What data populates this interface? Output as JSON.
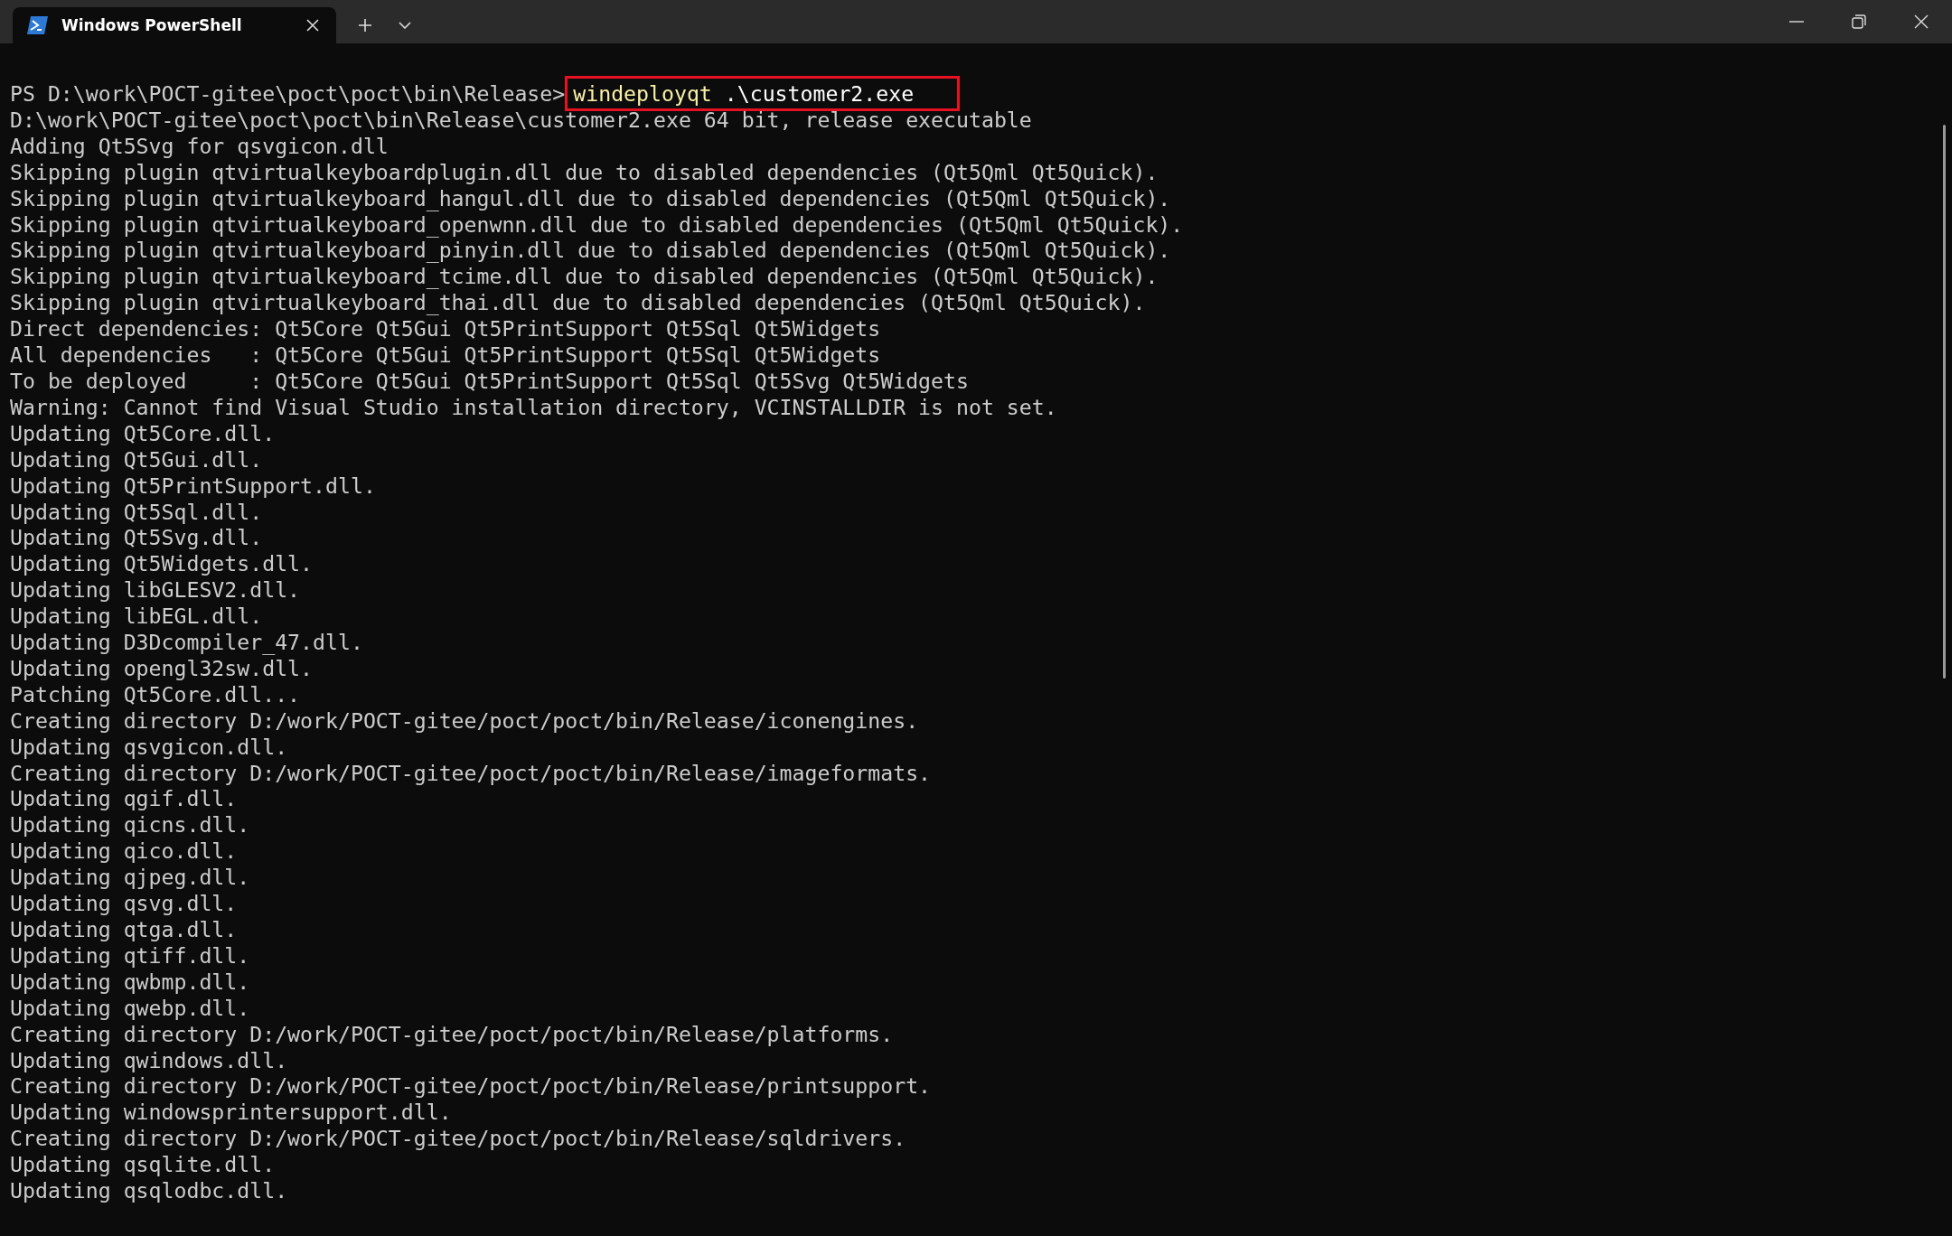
{
  "tab": {
    "title": "Windows PowerShell",
    "selected": true
  },
  "terminal": {
    "prompt": "PS D:\\work\\POCT-gitee\\poct\\poct\\bin\\Release>",
    "command_name": "windeployqt",
    "command_args": " .\\customer2.exe",
    "command_highlighted": true,
    "lines": [
      "D:\\work\\POCT-gitee\\poct\\poct\\bin\\Release\\customer2.exe 64 bit, release executable",
      "Adding Qt5Svg for qsvgicon.dll",
      "Skipping plugin qtvirtualkeyboardplugin.dll due to disabled dependencies (Qt5Qml Qt5Quick).",
      "Skipping plugin qtvirtualkeyboard_hangul.dll due to disabled dependencies (Qt5Qml Qt5Quick).",
      "Skipping plugin qtvirtualkeyboard_openwnn.dll due to disabled dependencies (Qt5Qml Qt5Quick).",
      "Skipping plugin qtvirtualkeyboard_pinyin.dll due to disabled dependencies (Qt5Qml Qt5Quick).",
      "Skipping plugin qtvirtualkeyboard_tcime.dll due to disabled dependencies (Qt5Qml Qt5Quick).",
      "Skipping plugin qtvirtualkeyboard_thai.dll due to disabled dependencies (Qt5Qml Qt5Quick).",
      "Direct dependencies: Qt5Core Qt5Gui Qt5PrintSupport Qt5Sql Qt5Widgets",
      "All dependencies   : Qt5Core Qt5Gui Qt5PrintSupport Qt5Sql Qt5Widgets",
      "To be deployed     : Qt5Core Qt5Gui Qt5PrintSupport Qt5Sql Qt5Svg Qt5Widgets",
      "Warning: Cannot find Visual Studio installation directory, VCINSTALLDIR is not set.",
      "Updating Qt5Core.dll.",
      "Updating Qt5Gui.dll.",
      "Updating Qt5PrintSupport.dll.",
      "Updating Qt5Sql.dll.",
      "Updating Qt5Svg.dll.",
      "Updating Qt5Widgets.dll.",
      "Updating libGLESV2.dll.",
      "Updating libEGL.dll.",
      "Updating D3Dcompiler_47.dll.",
      "Updating opengl32sw.dll.",
      "Patching Qt5Core.dll...",
      "Creating directory D:/work/POCT-gitee/poct/poct/bin/Release/iconengines.",
      "Updating qsvgicon.dll.",
      "Creating directory D:/work/POCT-gitee/poct/poct/bin/Release/imageformats.",
      "Updating qgif.dll.",
      "Updating qicns.dll.",
      "Updating qico.dll.",
      "Updating qjpeg.dll.",
      "Updating qsvg.dll.",
      "Updating qtga.dll.",
      "Updating qtiff.dll.",
      "Updating qwbmp.dll.",
      "Updating qwebp.dll.",
      "Creating directory D:/work/POCT-gitee/poct/poct/bin/Release/platforms.",
      "Updating qwindows.dll.",
      "Creating directory D:/work/POCT-gitee/poct/poct/bin/Release/printsupport.",
      "Updating windowsprintersupport.dll.",
      "Creating directory D:/work/POCT-gitee/poct/poct/bin/Release/sqldrivers.",
      "Updating qsqlite.dll.",
      "Updating qsqlodbc.dll."
    ]
  }
}
